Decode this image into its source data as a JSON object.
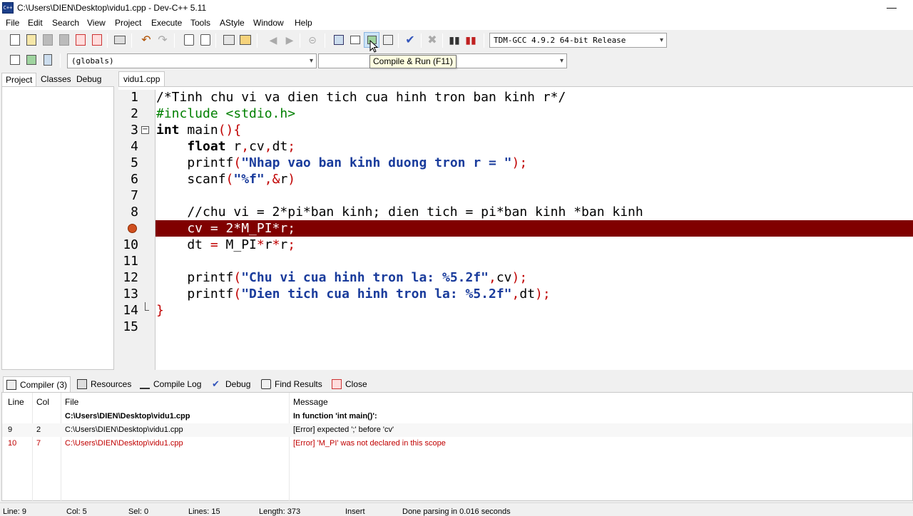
{
  "window": {
    "title": "C:\\Users\\DIEN\\Desktop\\vidu1.cpp - Dev-C++ 5.11",
    "minimize": "—"
  },
  "menu": [
    "File",
    "Edit",
    "Search",
    "View",
    "Project",
    "Execute",
    "Tools",
    "AStyle",
    "Window",
    "Help"
  ],
  "toolbar": {
    "compiler_select": "TDM-GCC 4.9.2 64-bit Release",
    "scope_select": "(globals)",
    "tooltip": "Compile & Run (F11)"
  },
  "left_tabs": [
    "Project",
    "Classes",
    "Debug"
  ],
  "editor": {
    "tab": "vidu1.cpp",
    "lines": [
      {
        "n": "1",
        "segments": [
          [
            "c-comment",
            "/*Tinh chu vi va dien tich cua hinh tron ban kinh r*/"
          ]
        ]
      },
      {
        "n": "2",
        "segments": [
          [
            "c-pre",
            "#include <stdio.h>"
          ]
        ]
      },
      {
        "n": "3",
        "segments": [
          [
            "c-kw",
            "int"
          ],
          [
            "",
            " main"
          ],
          [
            "c-sym",
            "(){"
          ]
        ]
      },
      {
        "n": "4",
        "segments": [
          [
            "",
            "    "
          ],
          [
            "c-kw",
            "float"
          ],
          [
            "",
            " r"
          ],
          [
            "c-sym",
            ","
          ],
          [
            "",
            "cv"
          ],
          [
            "c-sym",
            ","
          ],
          [
            "",
            "dt"
          ],
          [
            "c-sym",
            ";"
          ]
        ]
      },
      {
        "n": "5",
        "segments": [
          [
            "",
            "    printf"
          ],
          [
            "c-sym",
            "("
          ],
          [
            "c-str",
            "\"Nhap vao ban kinh duong tron r = \""
          ],
          [
            "c-sym",
            ");"
          ]
        ]
      },
      {
        "n": "6",
        "segments": [
          [
            "",
            "    scanf"
          ],
          [
            "c-sym",
            "("
          ],
          [
            "c-str",
            "\"%f\""
          ],
          [
            "c-sym",
            ",&"
          ],
          [
            "",
            "r"
          ],
          [
            "c-sym",
            ")"
          ]
        ]
      },
      {
        "n": "7",
        "segments": []
      },
      {
        "n": "8",
        "segments": [
          [
            "c-comment",
            "    //chu vi = 2*pi*ban kinh; dien tich = pi*ban kinh *ban kinh"
          ]
        ]
      },
      {
        "n": "9",
        "error": true,
        "segments": [
          [
            "",
            "    cv = 2*M_PI*r;"
          ]
        ]
      },
      {
        "n": "10",
        "segments": [
          [
            "",
            "    dt "
          ],
          [
            "c-sym",
            "="
          ],
          [
            "",
            " M_PI"
          ],
          [
            "c-sym",
            "*"
          ],
          [
            "",
            "r"
          ],
          [
            "c-sym",
            "*"
          ],
          [
            "",
            "r"
          ],
          [
            "c-sym",
            ";"
          ]
        ]
      },
      {
        "n": "11",
        "segments": []
      },
      {
        "n": "12",
        "segments": [
          [
            "",
            "    printf"
          ],
          [
            "c-sym",
            "("
          ],
          [
            "c-str",
            "\"Chu vi cua hinh tron la: %5.2f\""
          ],
          [
            "c-sym",
            ","
          ],
          [
            "",
            "cv"
          ],
          [
            "c-sym",
            ");"
          ]
        ]
      },
      {
        "n": "13",
        "segments": [
          [
            "",
            "    printf"
          ],
          [
            "c-sym",
            "("
          ],
          [
            "c-str",
            "\"Dien tich cua hinh tron la: %5.2f\""
          ],
          [
            "c-sym",
            ","
          ],
          [
            "",
            "dt"
          ],
          [
            "c-sym",
            ");"
          ]
        ]
      },
      {
        "n": "14",
        "segments": [
          [
            "c-sym",
            "}"
          ]
        ]
      },
      {
        "n": "15",
        "segments": []
      }
    ]
  },
  "bottom_tabs": [
    "Compiler (3)",
    "Resources",
    "Compile Log",
    "Debug",
    "Find Results",
    "Close"
  ],
  "results": {
    "headers": {
      "line": "Line",
      "col": "Col",
      "file": "File",
      "message": "Message"
    },
    "rows": [
      {
        "line": "",
        "col": "",
        "file": "C:\\Users\\DIEN\\Desktop\\vidu1.cpp",
        "message": "In function 'int main()':",
        "kind": "bold"
      },
      {
        "line": "9",
        "col": "2",
        "file": "C:\\Users\\DIEN\\Desktop\\vidu1.cpp",
        "message": "[Error] expected ';' before 'cv'",
        "kind": "normal"
      },
      {
        "line": "10",
        "col": "7",
        "file": "C:\\Users\\DIEN\\Desktop\\vidu1.cpp",
        "message": "[Error] 'M_PI' was not declared in this scope",
        "kind": "err"
      }
    ]
  },
  "status": {
    "line": "Line:   9",
    "col": "Col:   5",
    "sel": "Sel:   0",
    "lines": "Lines:   15",
    "length": "Length:   373",
    "mode": "Insert",
    "message": "Done parsing in 0.016 seconds"
  },
  "colors": {
    "error_line_bg": "#800000",
    "string": "#1a3c9c",
    "symbol": "#c00000",
    "preprocessor": "#008000"
  }
}
